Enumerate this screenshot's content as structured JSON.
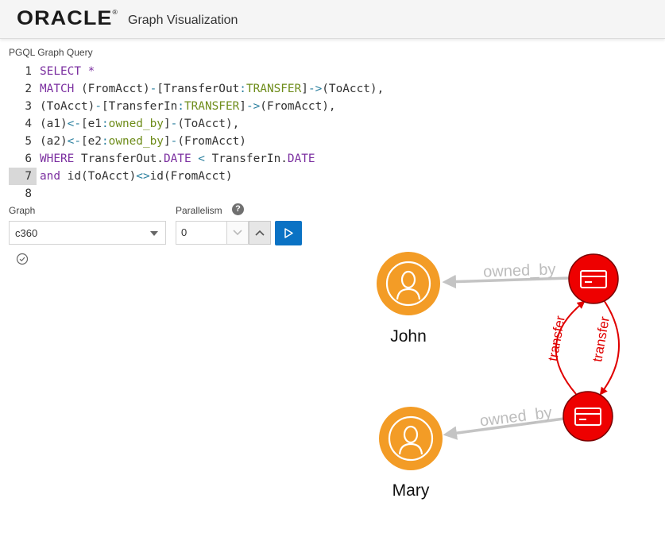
{
  "header": {
    "brand": "ORACLE",
    "brand_mark": "®",
    "app_title": "Graph Visualization"
  },
  "query": {
    "label": "PGQL Graph Query",
    "active_line": 7,
    "lines": [
      {
        "num": "1",
        "tokens": [
          [
            "kw",
            "SELECT "
          ],
          [
            "kw",
            "*"
          ]
        ]
      },
      {
        "num": "2",
        "tokens": [
          [
            "kw",
            "MATCH "
          ],
          [
            "t",
            "(FromAcct)"
          ],
          [
            "op",
            "-"
          ],
          [
            "t",
            "["
          ],
          [
            "t",
            "TransferOut"
          ],
          [
            "op",
            ":"
          ],
          [
            "lbl",
            "TRANSFER"
          ],
          [
            "t",
            "]"
          ],
          [
            "op",
            "->"
          ],
          [
            "t",
            "(ToAcct),"
          ]
        ]
      },
      {
        "num": "3",
        "tokens": [
          [
            "t",
            "(ToAcct)"
          ],
          [
            "op",
            "-"
          ],
          [
            "t",
            "["
          ],
          [
            "t",
            "TransferIn"
          ],
          [
            "op",
            ":"
          ],
          [
            "lbl",
            "TRANSFER"
          ],
          [
            "t",
            "]"
          ],
          [
            "op",
            "->"
          ],
          [
            "t",
            "(FromAcct),"
          ]
        ]
      },
      {
        "num": "4",
        "tokens": [
          [
            "t",
            "(a1)"
          ],
          [
            "op",
            "<-"
          ],
          [
            "t",
            "[e1"
          ],
          [
            "op",
            ":"
          ],
          [
            "lbl",
            "owned_by"
          ],
          [
            "t",
            "]"
          ],
          [
            "op",
            "-"
          ],
          [
            "t",
            "(ToAcct),"
          ]
        ]
      },
      {
        "num": "5",
        "tokens": [
          [
            "t",
            "(a2)"
          ],
          [
            "op",
            "<-"
          ],
          [
            "t",
            "[e2"
          ],
          [
            "op",
            ":"
          ],
          [
            "lbl",
            "owned_by"
          ],
          [
            "t",
            "]"
          ],
          [
            "op",
            "-"
          ],
          [
            "t",
            "(FromAcct)"
          ]
        ]
      },
      {
        "num": "6",
        "tokens": [
          [
            "kw",
            "WHERE "
          ],
          [
            "t",
            "TransferOut."
          ],
          [
            "kw",
            "DATE"
          ],
          [
            "op",
            " < "
          ],
          [
            "t",
            "TransferIn."
          ],
          [
            "kw",
            "DATE"
          ]
        ]
      },
      {
        "num": "7",
        "tokens": [
          [
            "kw",
            "and "
          ],
          [
            "t",
            "id(ToAcct)"
          ],
          [
            "op",
            "<>"
          ],
          [
            "t",
            "id(FromAcct)"
          ]
        ]
      },
      {
        "num": "8",
        "tokens": []
      }
    ]
  },
  "controls": {
    "graph_label": "Graph",
    "graph_value": "c360",
    "parallelism_label": "Parallelism",
    "help_icon": "?",
    "parallelism_value": "0"
  },
  "graph": {
    "nodes": {
      "john": {
        "label": "John",
        "type": "person",
        "color": "#f39c26"
      },
      "mary": {
        "label": "Mary",
        "type": "person",
        "color": "#f39c26"
      },
      "acct_top": {
        "type": "account",
        "color": "#ee0000"
      },
      "acct_bottom": {
        "type": "account",
        "color": "#ee0000"
      }
    },
    "edges": {
      "owned_by_top": "owned_by",
      "owned_by_bottom": "owned_by",
      "transfer_left": "transfer",
      "transfer_right": "transfer"
    },
    "edge_colors": {
      "owned_by": "#c4c4c4",
      "transfer": "#e00000"
    }
  }
}
